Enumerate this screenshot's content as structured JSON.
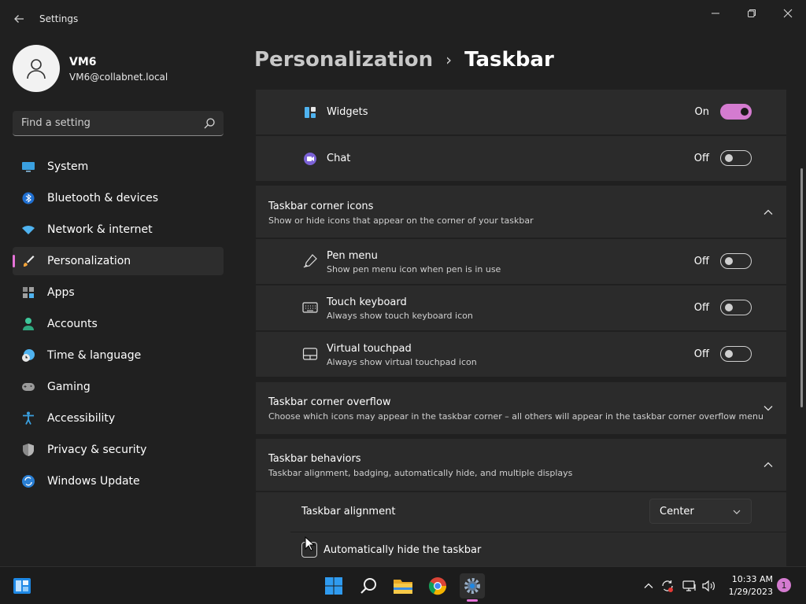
{
  "window": {
    "title": "Settings"
  },
  "profile": {
    "name": "VM6",
    "email": "VM6@collabnet.local"
  },
  "search": {
    "placeholder": "Find a setting"
  },
  "sidebar": {
    "items": [
      {
        "label": "System",
        "icon": "monitor-icon"
      },
      {
        "label": "Bluetooth & devices",
        "icon": "bluetooth-icon"
      },
      {
        "label": "Network & internet",
        "icon": "wifi-icon"
      },
      {
        "label": "Personalization",
        "icon": "brush-icon",
        "active": true
      },
      {
        "label": "Apps",
        "icon": "apps-icon"
      },
      {
        "label": "Accounts",
        "icon": "person-icon"
      },
      {
        "label": "Time & language",
        "icon": "clock-globe-icon"
      },
      {
        "label": "Gaming",
        "icon": "gamepad-icon"
      },
      {
        "label": "Accessibility",
        "icon": "accessibility-icon"
      },
      {
        "label": "Privacy & security",
        "icon": "shield-icon"
      },
      {
        "label": "Windows Update",
        "icon": "update-icon"
      }
    ]
  },
  "breadcrumb": {
    "parent": "Personalization",
    "separator": "›",
    "current": "Taskbar"
  },
  "items_rows": {
    "widgets": {
      "title": "Widgets",
      "state": "On",
      "on": true
    },
    "chat": {
      "title": "Chat",
      "state": "Off",
      "on": false
    }
  },
  "corner_icons": {
    "title": "Taskbar corner icons",
    "subtitle": "Show or hide icons that appear on the corner of your taskbar",
    "rows": [
      {
        "title": "Pen menu",
        "subtitle": "Show pen menu icon when pen is in use",
        "state": "Off"
      },
      {
        "title": "Touch keyboard",
        "subtitle": "Always show touch keyboard icon",
        "state": "Off"
      },
      {
        "title": "Virtual touchpad",
        "subtitle": "Always show virtual touchpad icon",
        "state": "Off"
      }
    ]
  },
  "corner_overflow": {
    "title": "Taskbar corner overflow",
    "subtitle": "Choose which icons may appear in the taskbar corner – all others will appear in the taskbar corner overflow menu"
  },
  "behaviors": {
    "title": "Taskbar behaviors",
    "subtitle": "Taskbar alignment, badging, automatically hide, and multiple displays",
    "alignment_label": "Taskbar alignment",
    "alignment_value": "Center",
    "autohide_label": "Automatically hide the taskbar"
  },
  "taskbar": {
    "time": "10:33 AM",
    "date": "1/29/2023",
    "notification_count": "1"
  },
  "colors": {
    "accent": "#d47bd0",
    "background": "#202020",
    "card": "#2b2b2b"
  }
}
